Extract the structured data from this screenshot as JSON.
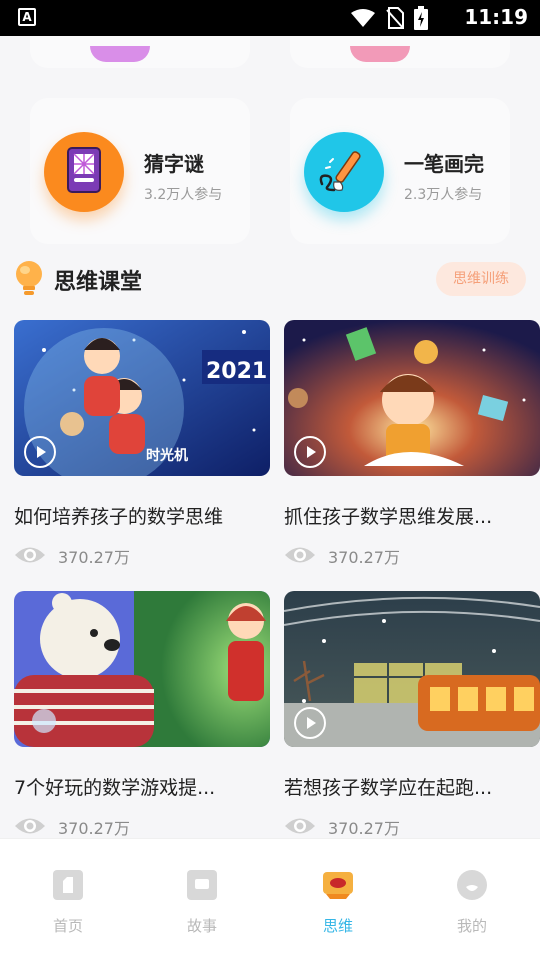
{
  "status_bar": {
    "time": "11:19",
    "notification_letter": "A"
  },
  "games": [
    {
      "title": "猜字谜",
      "participants": "3.2万人参与",
      "icon": "puzzle-book-icon",
      "color": "#fb8a1e"
    },
    {
      "title": "一笔画完",
      "participants": "2.3万人参与",
      "icon": "paintbrush-icon",
      "color": "#20c6e8"
    }
  ],
  "section": {
    "title": "思维课堂",
    "link_label": "思维训练"
  },
  "videos": [
    {
      "title": "如何培养孩子的数学思维",
      "views": "370.27万"
    },
    {
      "title": "抓住孩子数学思维发展...",
      "views": "370.27万"
    },
    {
      "title": "7个好玩的数学游戏提...",
      "views": "370.27万"
    },
    {
      "title": "若想孩子数学应在起跑...",
      "views": "370.27万"
    }
  ],
  "nav": [
    {
      "label": "首页",
      "icon": "home-icon"
    },
    {
      "label": "故事",
      "icon": "story-icon"
    },
    {
      "label": "思维",
      "icon": "thinking-icon",
      "active": true
    },
    {
      "label": "我的",
      "icon": "profile-icon"
    }
  ],
  "colors": {
    "accent": "#35b6e6",
    "link_bg": "#fde8de",
    "link_text": "#f5a07a"
  }
}
